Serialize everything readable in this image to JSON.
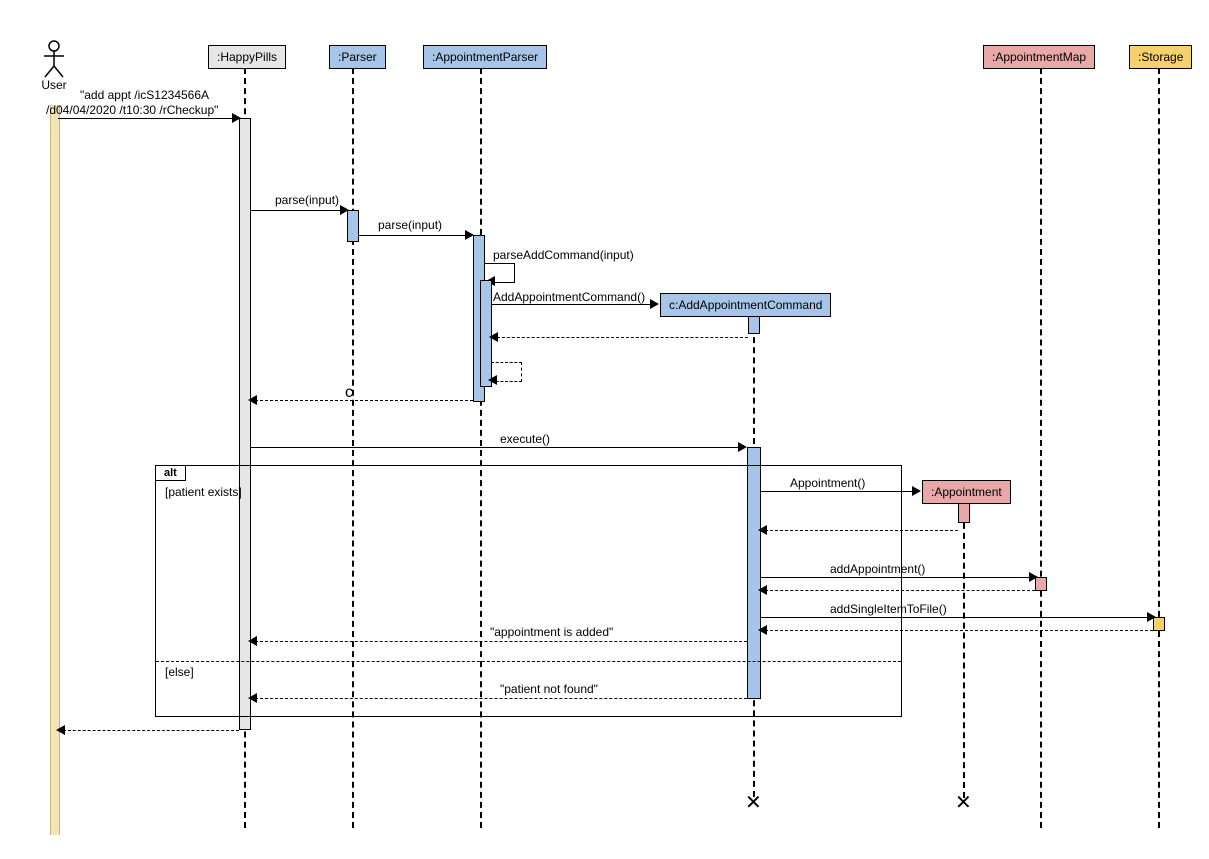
{
  "actor": {
    "name": "User"
  },
  "participants": {
    "happypills": ":HappyPills",
    "parser": ":Parser",
    "appointmentparser": ":AppointmentParser",
    "addapptcmd": "c:AddAppointmentCommand",
    "appointment": ":Appointment",
    "appointmentmap": ":AppointmentMap",
    "storage": ":Storage"
  },
  "messages": {
    "user_input1": "\"add appt /icS1234566A",
    "user_input2": "/d04/04/2020 /t10:30 /rCheckup\"",
    "parse1": "parse(input)",
    "parse2": "parse(input)",
    "parseAdd": "parseAddCommand(input)",
    "createCmd": "AddAppointmentCommand()",
    "returnC": "c",
    "execute": "execute()",
    "createAppt": "Appointment()",
    "addAppt": "addAppointment()",
    "addFile": "addSingleItemToFile()",
    "resultAdded": "\"appointment is added\"",
    "resultNotFound": "\"patient not found\""
  },
  "frame": {
    "alt": "alt",
    "guard1": "[patient exists]",
    "guard2": "[else]"
  }
}
